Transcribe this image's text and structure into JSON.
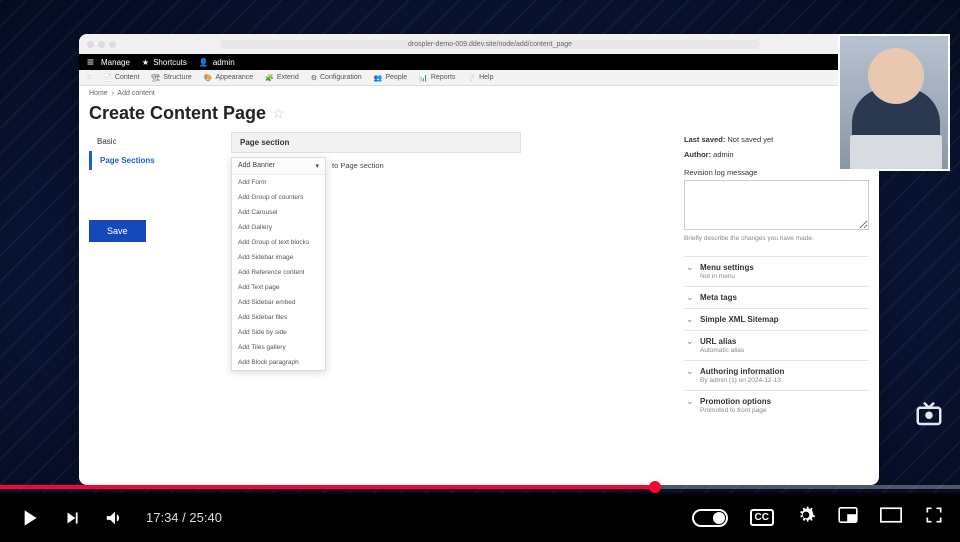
{
  "player": {
    "time_current": "17:34",
    "time_total": "25:40"
  },
  "browser": {
    "url": "drospler-demo-009.ddev.site/node/add/content_page"
  },
  "top_black": {
    "manage": "Manage",
    "shortcuts": "Shortcuts",
    "admin": "admin"
  },
  "top_gray": {
    "content": "Content",
    "structure": "Structure",
    "appearance": "Appearance",
    "extend": "Extend",
    "configuration": "Configuration",
    "people": "People",
    "reports": "Reports",
    "help": "Help"
  },
  "breadcrumbs": {
    "home": "Home",
    "add": "Add content"
  },
  "page_title": "Create Content Page",
  "vtabs": {
    "basic": "Basic",
    "sections": "Page Sections"
  },
  "save_btn": "Save",
  "section": {
    "header": "Page section",
    "add_toggle": "Add Banner",
    "outside": "to Page section",
    "options": [
      "Add Form",
      "Add Group of counters",
      "Add Carousel",
      "Add Gallery",
      "Add Group of text blocks",
      "Add Sidebar image",
      "Add Reference content",
      "Add Text page",
      "Add Sidebar embed",
      "Add Sidebar files",
      "Add Side by side",
      "Add Tiles gallery",
      "Add Block paragraph"
    ]
  },
  "sidebar_right": {
    "last_saved_label": "Last saved:",
    "last_saved_value": "Not saved yet",
    "author_label": "Author:",
    "author_value": "admin",
    "rev_label": "Revision log message",
    "rev_hint": "Briefly describe the changes you have made.",
    "accordion": [
      {
        "title": "Menu settings",
        "sub": "Not in menu"
      },
      {
        "title": "Meta tags",
        "sub": ""
      },
      {
        "title": "Simple XML Sitemap",
        "sub": ""
      },
      {
        "title": "URL alias",
        "sub": "Automatic alias"
      },
      {
        "title": "Authoring information",
        "sub": "By admin (1) on 2024-12-13"
      },
      {
        "title": "Promotion options",
        "sub": "Promoted to front page"
      }
    ]
  }
}
